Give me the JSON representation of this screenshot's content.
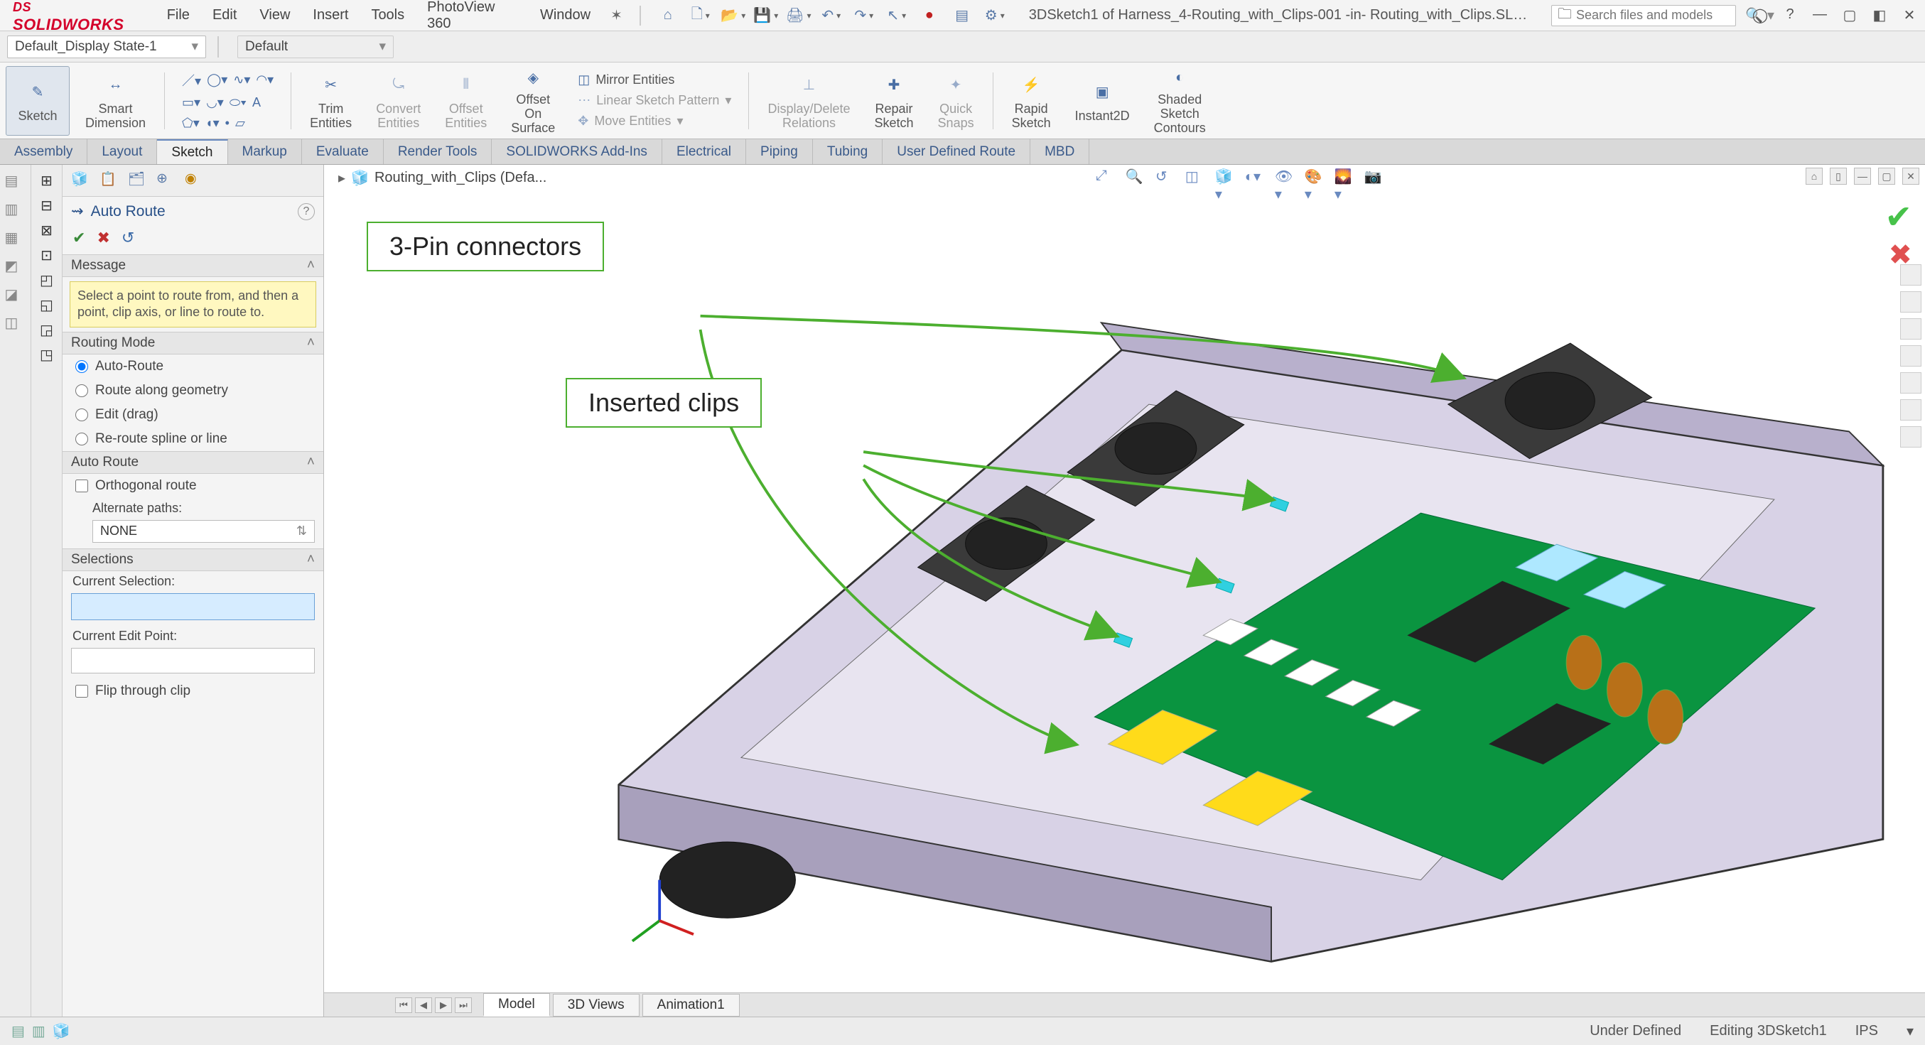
{
  "app": {
    "name": "SOLIDWORKS",
    "logo_prefix": "DS"
  },
  "menubar": {
    "items": [
      "File",
      "Edit",
      "View",
      "Insert",
      "Tools",
      "PhotoView 360",
      "Window"
    ],
    "doc_title": "3DSketch1 of Harness_4-Routing_with_Clips-001 -in- Routing_with_Clips.SLDASM *",
    "search_placeholder": "Search files and models"
  },
  "statebar": {
    "display_state": "Default_Display State-1",
    "config": "Default"
  },
  "ribbon": {
    "sketch": "Sketch",
    "smart_dim": "Smart\nDimension",
    "trim": "Trim\nEntities",
    "convert": "Convert\nEntities",
    "offset": "Offset\nEntities",
    "offset_on_surface": "Offset\nOn\nSurface",
    "mirror": "Mirror Entities",
    "linear": "Linear Sketch Pattern",
    "move": "Move Entities",
    "disp_del": "Display/Delete\nRelations",
    "repair": "Repair\nSketch",
    "quick_snaps": "Quick\nSnaps",
    "rapid": "Rapid\nSketch",
    "instant2d": "Instant2D",
    "shaded": "Shaded\nSketch\nContours"
  },
  "tabs": [
    "Assembly",
    "Layout",
    "Sketch",
    "Markup",
    "Evaluate",
    "Render Tools",
    "SOLIDWORKS Add-Ins",
    "Electrical",
    "Piping",
    "Tubing",
    "User Defined Route",
    "MBD"
  ],
  "tabs_active_index": 2,
  "breadcrumb": "Routing_with_Clips (Defa...",
  "panel": {
    "title": "Auto Route",
    "message_head": "Message",
    "message": "Select a point to route from, and then a point, clip axis, or line to route to.",
    "routing_mode_head": "Routing Mode",
    "modes": {
      "auto": "Auto-Route",
      "along": "Route along geometry",
      "edit": "Edit (drag)",
      "reroute": "Re-route spline or line"
    },
    "auto_route_head": "Auto Route",
    "orthogonal": "Orthogonal route",
    "alt_paths_label": "Alternate paths:",
    "alt_paths_value": "NONE",
    "selections_head": "Selections",
    "cur_sel_label": "Current Selection:",
    "cur_edit_label": "Current Edit Point:",
    "flip": "Flip through clip"
  },
  "annotations": {
    "connectors": "3-Pin connectors",
    "clips": "Inserted clips"
  },
  "viewtabs": {
    "model": "Model",
    "views3d": "3D Views",
    "animation": "Animation1"
  },
  "status": {
    "under_defined": "Under Defined",
    "editing": "Editing 3DSketch1",
    "units": "IPS"
  }
}
